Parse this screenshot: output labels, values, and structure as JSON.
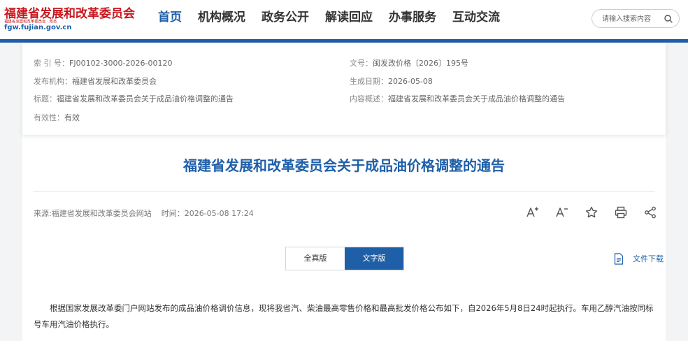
{
  "site": {
    "logo_title": "福建省发展和改革委员会",
    "logo_sub": "福建省发展和改革委员会 · 政务",
    "logo_url": "fgw.fujian.gov.cn"
  },
  "nav": {
    "items": [
      "首页",
      "机构概况",
      "政务公开",
      "解读回应",
      "办事服务",
      "互动交流"
    ]
  },
  "search": {
    "placeholder": "请输入搜索内容"
  },
  "meta": {
    "index_key": "索 引 号：",
    "index_val": "FJ00102-3000-2026-00120",
    "docno_key": "文号：",
    "docno_val": "闽发改价格〔2026〕195号",
    "org_key": "发布机构：",
    "org_val": "福建省发展和改革委员会",
    "date_key": "生成日期：",
    "date_val": "2026-05-08",
    "title_key": "标题：",
    "title_val": "福建省发展和改革委员会关于成品油价格调整的通告",
    "summary_key": "内容概述：",
    "summary_val": "福建省发展和改革委员会关于成品油价格调整的通告",
    "valid_key": "有效性：",
    "valid_val": "有效"
  },
  "article": {
    "title": "福建省发展和改革委员会关于成品油价格调整的通告",
    "source": "来源:福建省发展和改革委员会网站",
    "time_label": "时间：",
    "time_val": "2026-05-08 17:24",
    "body": "根据国家发展改革委门户网站发布的成品油价格调价信息，现将我省汽、柴油最高零售价格和最高批发价格公布如下，自2026年5月8日24时起执行。车用乙醇汽油按同标号车用汽油价格执行。"
  },
  "tabs": {
    "full": "全真版",
    "text": "文字版"
  },
  "download": {
    "label": "文件下载"
  },
  "colors": {
    "brand_blue": "#1f5fa8",
    "logo_red": "#c8161d"
  }
}
